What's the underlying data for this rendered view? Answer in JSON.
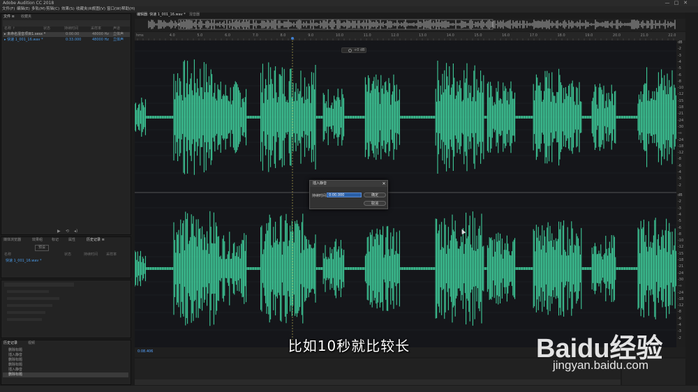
{
  "app": {
    "title": "Adobe Audition CC 2018"
  },
  "window_controls": {
    "minimize": "—",
    "maximize": "□",
    "close": "✕"
  },
  "menu": [
    "文件(F)",
    "编辑(E)",
    "多轨(M)",
    "剪辑(C)",
    "效果(S)",
    "收藏夹(R)",
    "视图(V)",
    "窗口(W)",
    "帮助(H)"
  ],
  "files_panel": {
    "tabs": [
      "文件 ≡",
      "收藏夹"
    ],
    "columns": [
      "名称 ↑",
      "状态",
      "持续时间",
      "采样率",
      "声道"
    ],
    "rows": [
      {
        "name": "▸ 未命名混音项目1.sesx *",
        "duration": "0:00:00",
        "rate": "48000 Hz",
        "channel": "立体声"
      },
      {
        "name": "▸ 快速 1_001_16.wav *",
        "duration": "0:33.000",
        "rate": "48000 Hz",
        "channel": "立体声"
      }
    ]
  },
  "effects_panel": {
    "tabs": [
      "媒体浏览器",
      "效果组",
      "标记",
      "属性",
      "历史记录 ≡"
    ],
    "button": "预设",
    "columns": [
      "名称",
      "状态",
      "持续时间",
      "采样率"
    ],
    "file": "快速 1_001_16.wav *"
  },
  "history_panel": {
    "tabs": [
      "历史记录",
      "视频"
    ],
    "items": [
      "删除标题",
      "插入静音",
      "删除标题",
      "删除标题",
      "插入静音",
      "删除标题"
    ]
  },
  "editor": {
    "tabs": [
      "编辑器: 快速 1_001_16.wav *",
      "混音器"
    ],
    "ruler_labels": [
      "hms",
      "4.0",
      "5.0",
      "6.0",
      "7.0",
      "8.0",
      "9.0",
      "10.0",
      "11.0",
      "12.0",
      "13.0",
      "14.0",
      "15.0",
      "16.0",
      "17.0",
      "18.0",
      "19.0",
      "20.0",
      "21.0",
      "22.0"
    ],
    "db_labels_top": [
      "dB",
      "-2",
      "-3",
      "-4",
      "-5",
      "-6",
      "-8",
      "-10",
      "-12",
      "-15",
      "-18",
      "-21",
      "-24",
      "-30",
      "-∞",
      "-24",
      "-18",
      "-12",
      "-8",
      "-6",
      "-4",
      "-3",
      "-2"
    ],
    "db_labels_bottom": [
      "dB",
      "-2",
      "-3",
      "-4",
      "-5",
      "-6",
      "-8",
      "-10",
      "-12",
      "-15",
      "-18",
      "-21",
      "-24",
      "-30",
      "-∞",
      "-24",
      "-18",
      "-12",
      "-8",
      "-6",
      "-4",
      "-3",
      "-2"
    ],
    "time_readout": "0:08.406",
    "hud": "+0 dB",
    "waveform_color": "#3fcc9a"
  },
  "dialog": {
    "title": "插入静音",
    "label": "持续时间:",
    "value": "0:00.000",
    "ok": "确定",
    "cancel": "取消",
    "close": "✕"
  },
  "subtitle": "比如10秒就比较长",
  "watermark": {
    "brand": "Baidu经验",
    "url": "jingyan.baidu.com"
  }
}
